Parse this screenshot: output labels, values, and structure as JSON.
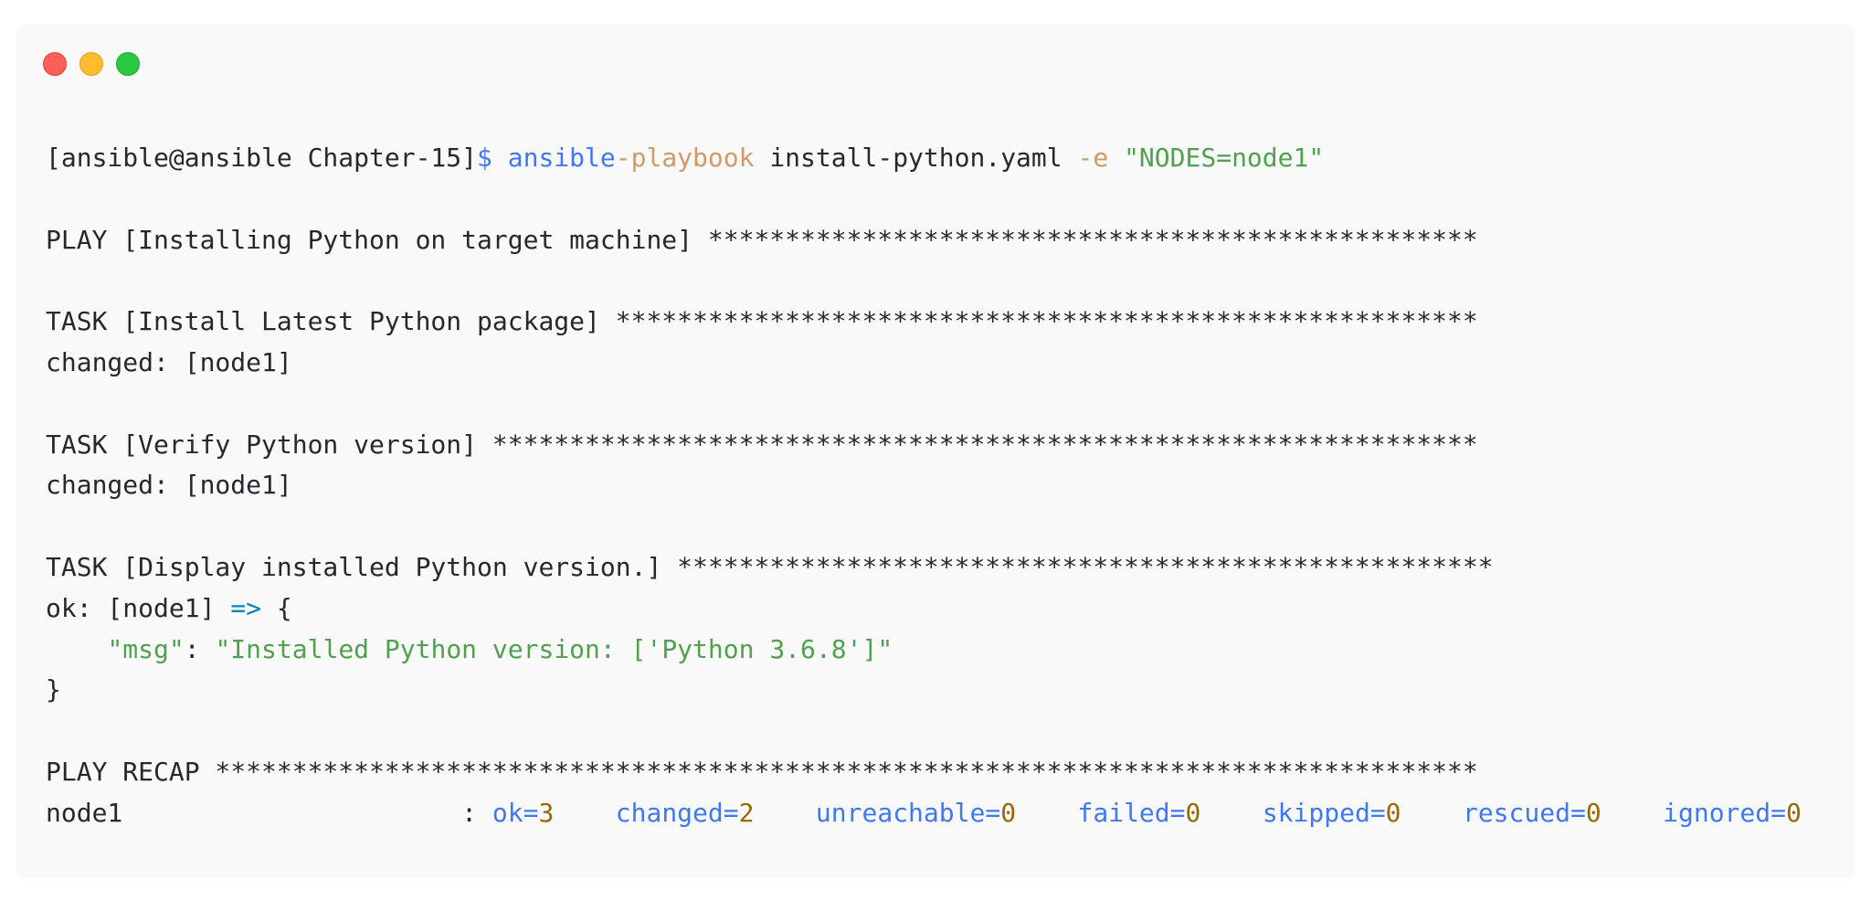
{
  "colors": {
    "window_bg": "#f9f9f9",
    "text": "#24292e",
    "prompt_symbol": "#4078f2",
    "command_part1": "#4078f2",
    "command_part2": "#d19a66",
    "flag": "#d19a66",
    "string": "#50a14f",
    "recap_key": "#4078f2",
    "recap_value": "#986801",
    "dot_red": "#ff5f56",
    "dot_yellow": "#ffbd2e",
    "dot_green": "#27c93f"
  },
  "window_controls": [
    "close-dot",
    "minimize-dot",
    "maximize-dot"
  ],
  "prompt": {
    "context": "[ansible@ansible Chapter-15]",
    "symbol": "$",
    "cmd_a": "ansible",
    "cmd_b": "-playbook",
    "arg": "install-python.yaml",
    "flag": "-e",
    "flag_value": "\"NODES=node1\""
  },
  "play_line": "PLAY [Installing Python on target machine] **************************************************",
  "task1": {
    "header": "TASK [Install Latest Python package] ********************************************************",
    "result": "changed: [node1]"
  },
  "task2": {
    "header": "TASK [Verify Python version] ****************************************************************",
    "result": "changed: [node1]"
  },
  "task3": {
    "header": "TASK [Display installed Python version.] *****************************************************",
    "result_prefix": "ok: [node1] ",
    "arrow": "=>",
    "brace_open": " {",
    "msg_indent": "    ",
    "msg_key": "\"msg\"",
    "msg_colon": ": ",
    "msg_value": "\"Installed Python version: ['Python 3.6.8']\"",
    "brace_close": "}"
  },
  "recap": {
    "header": "PLAY RECAP **********************************************************************************",
    "host": "node1",
    "separator": "                      : ",
    "gap": "    ",
    "stats": [
      {
        "key": "ok=",
        "value": "3"
      },
      {
        "key": "changed=",
        "value": "2"
      },
      {
        "key": "unreachable=",
        "value": "0"
      },
      {
        "key": "failed=",
        "value": "0"
      },
      {
        "key": "skipped=",
        "value": "0"
      },
      {
        "key": "rescued=",
        "value": "0"
      },
      {
        "key": "ignored=",
        "value": "0"
      }
    ]
  }
}
